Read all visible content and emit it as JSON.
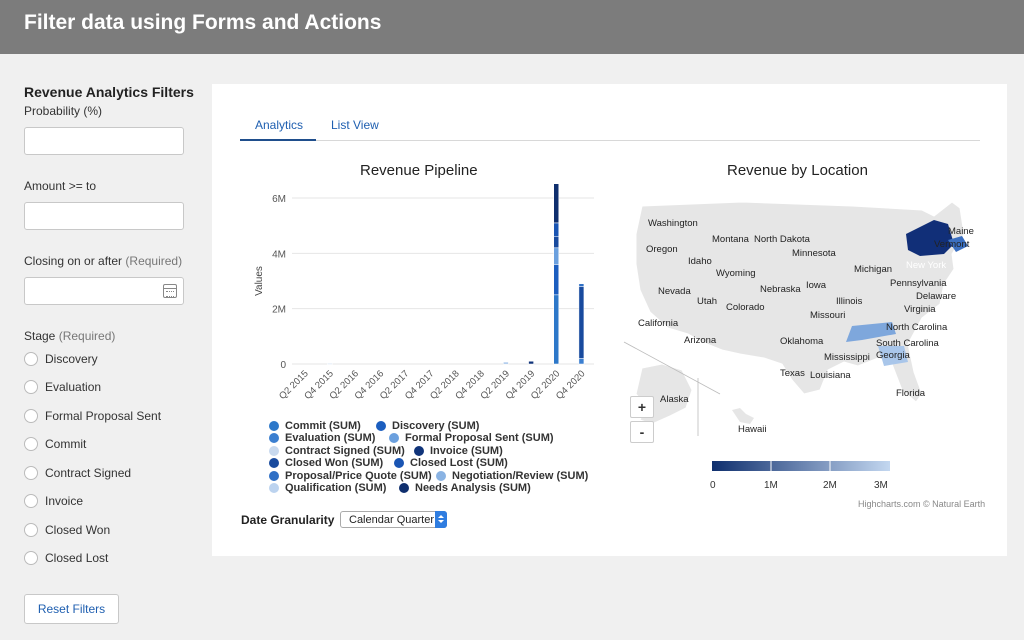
{
  "header": {
    "title": "Filter data using Forms and Actions"
  },
  "sidebar": {
    "title": "Revenue Analytics Filters",
    "probability_label": "Probability (%)",
    "probability_value": "",
    "amount_label": "Amount >= to",
    "amount_value": "",
    "closing_label": "Closing on or after",
    "closing_required": "(Required)",
    "closing_value": "",
    "stage_label": "Stage",
    "stage_required": "(Required)",
    "stages": [
      "Discovery",
      "Evaluation",
      "Formal Proposal Sent",
      "Commit",
      "Contract Signed",
      "Invoice",
      "Closed Won",
      "Closed Lost"
    ],
    "reset_label": "Reset Filters"
  },
  "tabs": [
    {
      "label": "Analytics",
      "active": true
    },
    {
      "label": "List View",
      "active": false
    }
  ],
  "pipeline": {
    "title": "Revenue Pipeline",
    "granularity_label": "Date Granularity",
    "granularity_value": "Calendar Quarter"
  },
  "location": {
    "title": "Revenue by Location",
    "zoom_in": "+",
    "zoom_out": "-",
    "color_axis_labels": [
      "0",
      "1M",
      "2M",
      "3M"
    ],
    "credit": "Highcharts.com © Natural Earth",
    "state_labels": [
      "Washington",
      "Oregon",
      "California",
      "Nevada",
      "Idaho",
      "Montana",
      "Wyoming",
      "Utah",
      "Arizona",
      "Colorado",
      "North Dakota",
      "Minnesota",
      "Nebraska",
      "Iowa",
      "Missouri",
      "Oklahoma",
      "Texas",
      "Illinois",
      "Michigan",
      "Mississippi",
      "Louisiana",
      "Maine",
      "Vermont",
      "New York",
      "Pennsylvania",
      "Delaware",
      "Virginia",
      "North Carolina",
      "South Carolina",
      "Georgia",
      "Florida",
      "Alaska",
      "Hawaii"
    ]
  },
  "chart_data": [
    {
      "type": "bar",
      "title": "Revenue Pipeline",
      "xlabel": "",
      "ylabel": "Values",
      "ylim": [
        0,
        6000000
      ],
      "yticks": [
        "0",
        "2M",
        "4M",
        "6M"
      ],
      "categories": [
        "Q2 2015",
        "Q4 2015",
        "Q2 2016",
        "Q4 2016",
        "Q2 2017",
        "Q4 2017",
        "Q2 2018",
        "Q4 2018",
        "Q2 2019",
        "Q4 2019",
        "Q2 2020",
        "Q4 2020"
      ],
      "legend_position": "bottom",
      "series": [
        {
          "name": "Commit (SUM)",
          "color": "#2d78c9",
          "values": [
            0,
            0,
            0,
            0,
            0,
            0,
            0,
            0,
            0,
            0,
            2500000,
            0
          ]
        },
        {
          "name": "Discovery (SUM)",
          "color": "#1c5ebf",
          "values": [
            0,
            0,
            0,
            0,
            0,
            0,
            0,
            0,
            0,
            0,
            1100000,
            0
          ]
        },
        {
          "name": "Evaluation (SUM)",
          "color": "#3b7fd0",
          "values": [
            0,
            0,
            0,
            0,
            0,
            0,
            0,
            0,
            40000,
            0,
            0,
            200000
          ]
        },
        {
          "name": "Formal Proposal Sent (SUM)",
          "color": "#6ba0de",
          "values": [
            0,
            0,
            0,
            0,
            0,
            0,
            0,
            0,
            0,
            0,
            600000,
            0
          ]
        },
        {
          "name": "Contract Signed (SUM)",
          "color": "#c8d9ee",
          "values": [
            0,
            20000,
            0,
            0,
            0,
            0,
            0,
            0,
            0,
            0,
            0,
            0
          ]
        },
        {
          "name": "Invoice (SUM)",
          "color": "#10347a",
          "values": [
            0,
            0,
            0,
            0,
            0,
            0,
            0,
            0,
            0,
            100000,
            0,
            0
          ]
        },
        {
          "name": "Closed Won (SUM)",
          "color": "#184a9e",
          "values": [
            0,
            0,
            0,
            0,
            0,
            0,
            0,
            0,
            0,
            0,
            400000,
            2600000
          ]
        },
        {
          "name": "Closed Lost (SUM)",
          "color": "#1a55b3",
          "values": [
            0,
            0,
            0,
            0,
            0,
            0,
            0,
            0,
            0,
            0,
            500000,
            0
          ]
        },
        {
          "name": "Proposal/Price Quote (SUM)",
          "color": "#2e6fc5",
          "values": [
            0,
            0,
            0,
            0,
            0,
            0,
            0,
            0,
            0,
            0,
            0,
            100000
          ]
        },
        {
          "name": "Negotiation/Review (SUM)",
          "color": "#8ab3e3",
          "values": [
            0,
            0,
            0,
            0,
            0,
            0,
            0,
            0,
            30000,
            0,
            0,
            0
          ]
        },
        {
          "name": "Qualification (SUM)",
          "color": "#bcd3ef",
          "values": [
            0,
            0,
            0,
            0,
            0,
            0,
            0,
            0,
            0,
            0,
            0,
            0
          ]
        },
        {
          "name": "Needs Analysis (SUM)",
          "color": "#0f2f6e",
          "values": [
            0,
            0,
            0,
            0,
            0,
            0,
            0,
            0,
            0,
            0,
            3100000,
            0
          ]
        }
      ]
    }
  ]
}
